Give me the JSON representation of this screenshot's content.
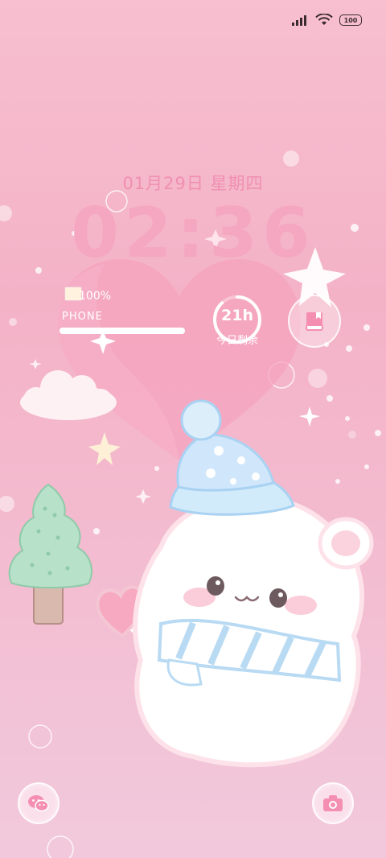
{
  "status_bar": {
    "battery": "100"
  },
  "lockscreen": {
    "date": "01月29日   星期四",
    "time": "02:36"
  },
  "widget": {
    "battery_percent": "100%",
    "battery_level": 1.0,
    "device_label": "PHONE",
    "ring_value": "21h",
    "ring_label": "今日剩余",
    "ring_fraction": 0.88
  },
  "shortcuts": {
    "left": "wechat-icon",
    "right": "camera-icon"
  },
  "colors": {
    "accent": "#f08fb2",
    "heart": "#f49ab6",
    "scarf": "#bcdcf5"
  }
}
